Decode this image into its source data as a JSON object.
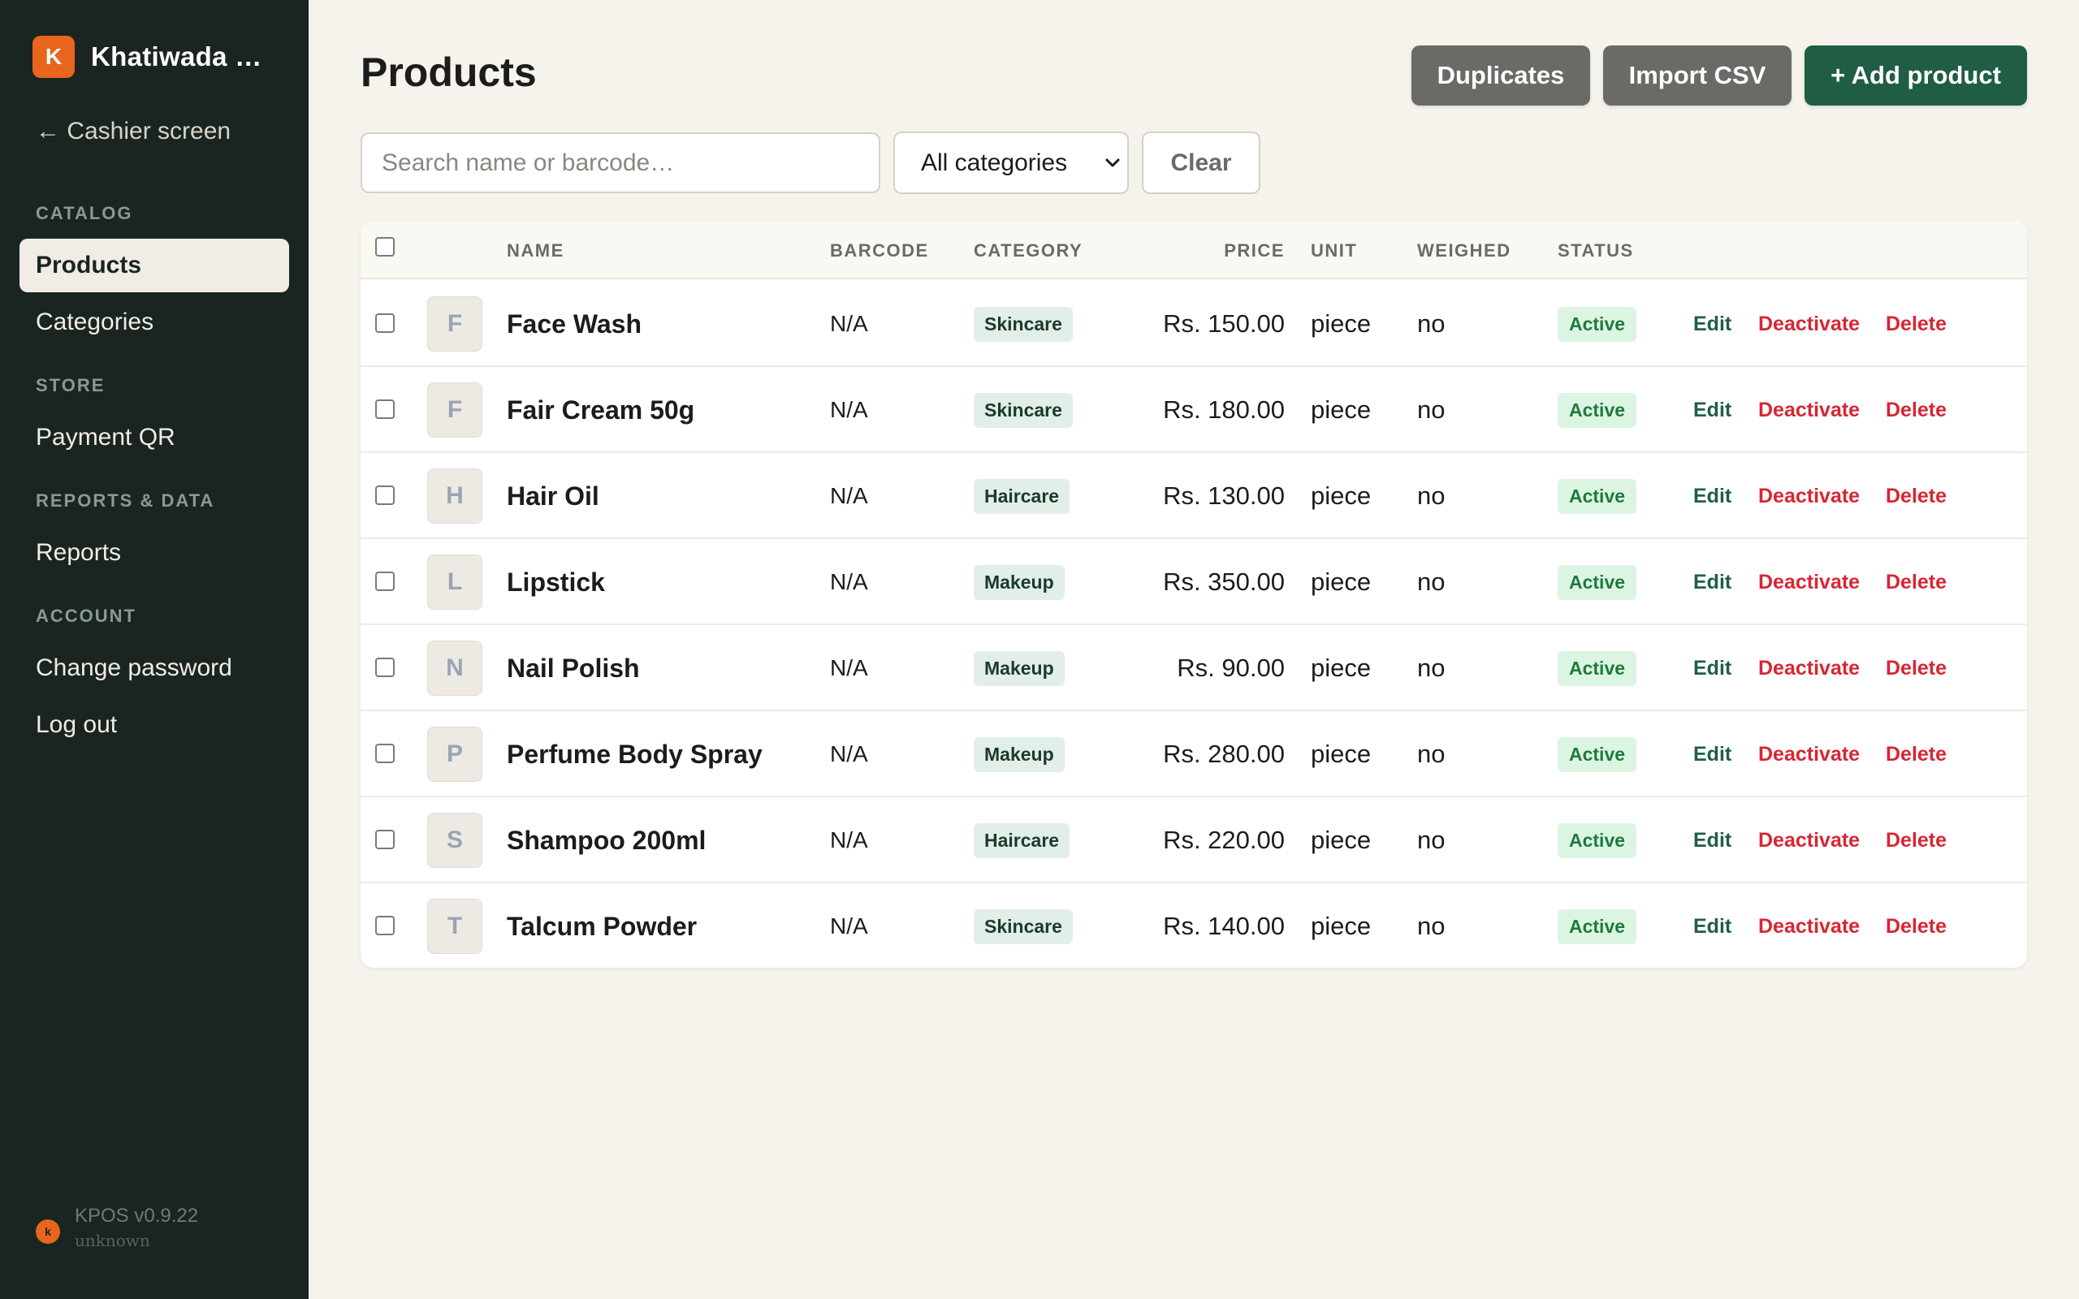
{
  "sidebar": {
    "brand_initial": "K",
    "brand_name": "Khatiwada …",
    "cashier_link": "← Cashier screen",
    "sections": {
      "catalog": "CATALOG",
      "store": "STORE",
      "reports": "REPORTS & DATA",
      "account": "ACCOUNT"
    },
    "items": {
      "products": "Products",
      "categories": "Categories",
      "payment_qr": "Payment QR",
      "reports": "Reports",
      "change_password": "Change password",
      "logout": "Log out"
    },
    "version": "KPOS v0.9.22",
    "version_sub": "unknown",
    "version_dot": "k"
  },
  "header": {
    "title": "Products",
    "duplicates_label": "Duplicates",
    "import_label": "Import CSV",
    "add_label": "+ Add product"
  },
  "filters": {
    "search_placeholder": "Search name or barcode…",
    "category_selected": "All categories",
    "clear_label": "Clear"
  },
  "table": {
    "columns": {
      "name": "NAME",
      "barcode": "BARCODE",
      "category": "CATEGORY",
      "price": "PRICE",
      "unit": "UNIT",
      "weighed": "WEIGHED",
      "status": "STATUS"
    },
    "actions": {
      "edit": "Edit",
      "deactivate": "Deactivate",
      "delete": "Delete"
    },
    "rows": [
      {
        "initial": "F",
        "name": "Face Wash",
        "barcode": "N/A",
        "category": "Skincare",
        "price": "Rs. 150.00",
        "unit": "piece",
        "weighed": "no",
        "status": "Active"
      },
      {
        "initial": "F",
        "name": "Fair Cream 50g",
        "barcode": "N/A",
        "category": "Skincare",
        "price": "Rs. 180.00",
        "unit": "piece",
        "weighed": "no",
        "status": "Active"
      },
      {
        "initial": "H",
        "name": "Hair Oil",
        "barcode": "N/A",
        "category": "Haircare",
        "price": "Rs. 130.00",
        "unit": "piece",
        "weighed": "no",
        "status": "Active"
      },
      {
        "initial": "L",
        "name": "Lipstick",
        "barcode": "N/A",
        "category": "Makeup",
        "price": "Rs. 350.00",
        "unit": "piece",
        "weighed": "no",
        "status": "Active"
      },
      {
        "initial": "N",
        "name": "Nail Polish",
        "barcode": "N/A",
        "category": "Makeup",
        "price": "Rs. 90.00",
        "unit": "piece",
        "weighed": "no",
        "status": "Active"
      },
      {
        "initial": "P",
        "name": "Perfume Body Spray",
        "barcode": "N/A",
        "category": "Makeup",
        "price": "Rs. 280.00",
        "unit": "piece",
        "weighed": "no",
        "status": "Active"
      },
      {
        "initial": "S",
        "name": "Shampoo 200ml",
        "barcode": "N/A",
        "category": "Haircare",
        "price": "Rs. 220.00",
        "unit": "piece",
        "weighed": "no",
        "status": "Active"
      },
      {
        "initial": "T",
        "name": "Talcum Powder",
        "barcode": "N/A",
        "category": "Skincare",
        "price": "Rs. 140.00",
        "unit": "piece",
        "weighed": "no",
        "status": "Active"
      }
    ]
  },
  "colors": {
    "sidebar_bg": "#1a2521",
    "accent_green": "#1f5e45",
    "brand_orange": "#e8651d",
    "danger_red": "#d72633",
    "page_bg": "#f6f3ec"
  }
}
